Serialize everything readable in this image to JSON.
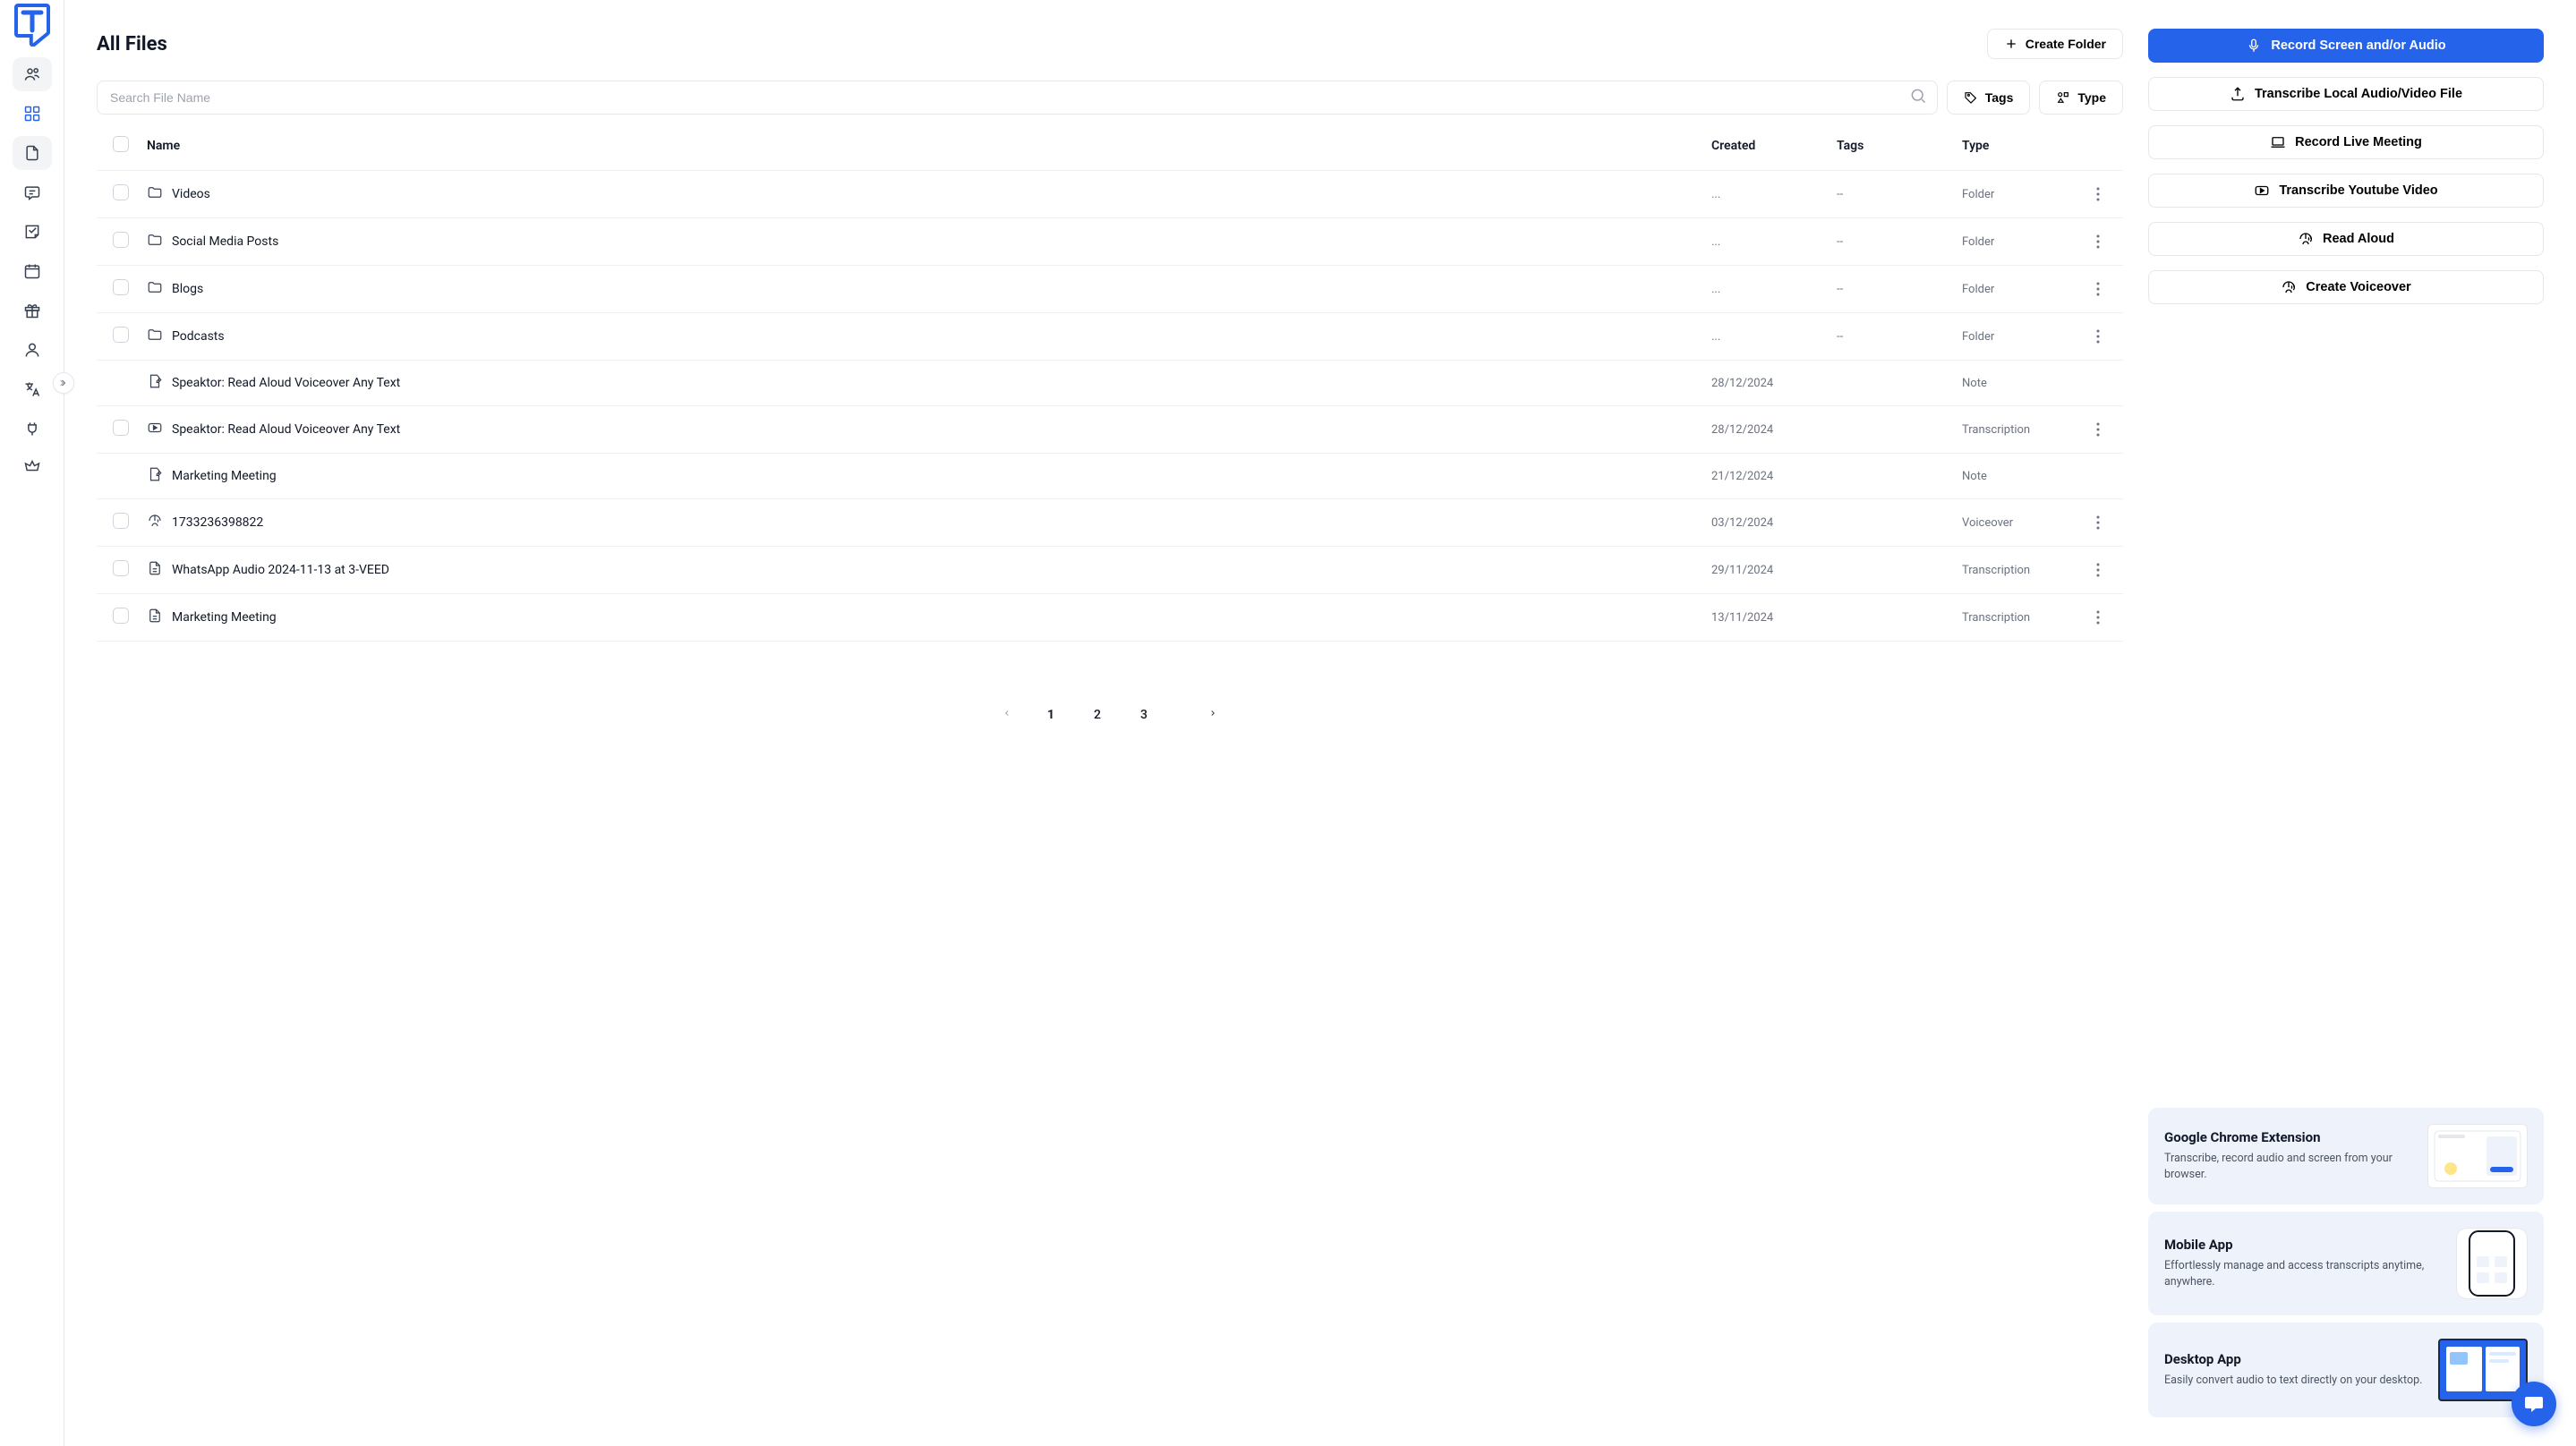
{
  "page": {
    "title": "All Files"
  },
  "buttons": {
    "create_folder": "Create Folder",
    "tags": "Tags",
    "type": "Type"
  },
  "search": {
    "placeholder": "Search File Name"
  },
  "table": {
    "headers": {
      "name": "Name",
      "created": "Created",
      "tags": "Tags",
      "type": "Type"
    },
    "rows": [
      {
        "icon": "folder",
        "name": "Videos",
        "created": "...",
        "tags": "--",
        "type": "Folder",
        "selectable": true,
        "actions": true
      },
      {
        "icon": "folder",
        "name": "Social Media Posts",
        "created": "...",
        "tags": "--",
        "type": "Folder",
        "selectable": true,
        "actions": true
      },
      {
        "icon": "folder",
        "name": "Blogs",
        "created": "...",
        "tags": "--",
        "type": "Folder",
        "selectable": true,
        "actions": true
      },
      {
        "icon": "folder",
        "name": "Podcasts",
        "created": "...",
        "tags": "--",
        "type": "Folder",
        "selectable": true,
        "actions": true
      },
      {
        "icon": "note",
        "name": "Speaktor: Read Aloud Voiceover Any Text",
        "created": "28/12/2024",
        "tags": "",
        "type": "Note",
        "selectable": false,
        "actions": false
      },
      {
        "icon": "video",
        "name": "Speaktor: Read Aloud Voiceover Any Text",
        "created": "28/12/2024",
        "tags": "",
        "type": "Transcription",
        "selectable": true,
        "actions": true
      },
      {
        "icon": "note",
        "name": "Marketing Meeting",
        "created": "21/12/2024",
        "tags": "",
        "type": "Note",
        "selectable": false,
        "actions": false
      },
      {
        "icon": "voice",
        "name": "1733236398822",
        "created": "03/12/2024",
        "tags": "",
        "type": "Voiceover",
        "selectable": true,
        "actions": true
      },
      {
        "icon": "doc",
        "name": "WhatsApp Audio 2024-11-13 at 3-VEED",
        "created": "29/11/2024",
        "tags": "",
        "type": "Transcription",
        "selectable": true,
        "actions": true
      },
      {
        "icon": "doc",
        "name": "Marketing Meeting",
        "created": "13/11/2024",
        "tags": "",
        "type": "Transcription",
        "selectable": true,
        "actions": true
      }
    ]
  },
  "pagination": {
    "pages": [
      "1",
      "2",
      "3"
    ],
    "active": 0
  },
  "actions": {
    "record_screen": "Record Screen and/or Audio",
    "transcribe_local": "Transcribe Local Audio/Video File",
    "record_meeting": "Record Live Meeting",
    "transcribe_youtube": "Transcribe Youtube Video",
    "read_aloud": "Read Aloud",
    "create_voiceover": "Create Voiceover"
  },
  "promos": [
    {
      "title": "Google Chrome Extension",
      "desc": "Transcribe, record audio and screen from your browser.",
      "img": "browser"
    },
    {
      "title": "Mobile App",
      "desc": "Effortlessly manage and access transcripts anytime, anywhere.",
      "img": "phone"
    },
    {
      "title": "Desktop App",
      "desc": "Easily convert audio to text directly on your desktop.",
      "img": "laptop"
    }
  ]
}
